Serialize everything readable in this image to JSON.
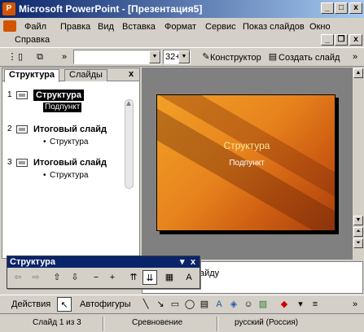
{
  "window": {
    "app_title": "Microsoft PowerPoint - [Презентация5]",
    "controls": {
      "minimize": "_",
      "maximize": "□",
      "close": "x"
    }
  },
  "menu": {
    "items": [
      "Файл",
      "Правка",
      "Вид",
      "Вставка",
      "Формат",
      "Сервис",
      "Показ слайдов",
      "Окно"
    ],
    "help": "Справка",
    "doc_controls": {
      "minimize": "_",
      "restore": "❐",
      "close": "x"
    }
  },
  "toolbar": {
    "font_name": "",
    "font_size": "32+",
    "designer_label": "Конструктор",
    "new_slide_label": "Создать слайд"
  },
  "left_pane": {
    "tabs": [
      "Структура",
      "Слайды"
    ],
    "close": "x",
    "outline": [
      {
        "num": "1",
        "title": "Структура",
        "bullet": "Подпункт",
        "selected": true
      },
      {
        "num": "2",
        "title": "Итоговый слайд",
        "bullet": "Структура",
        "selected": false
      },
      {
        "num": "3",
        "title": "Итоговый слайд",
        "bullet": "Структура",
        "selected": false
      }
    ]
  },
  "slide": {
    "title": "Структура",
    "subtitle": "Подпункт",
    "colors": {
      "light": "#f2a127",
      "dark": "#a9400e",
      "title": "#f8e89a"
    }
  },
  "notes": {
    "partial_text": "айду"
  },
  "outline_toolbar": {
    "title": "Структура",
    "close": "x",
    "menu_arrow": "▾"
  },
  "drawing_toolbar": {
    "actions_label": "Действия",
    "autoshapes_label": "Автофигуры"
  },
  "status": {
    "slide": "Слайд 1 из 3",
    "design": "Сревновение",
    "language": "русский (Россия)"
  }
}
